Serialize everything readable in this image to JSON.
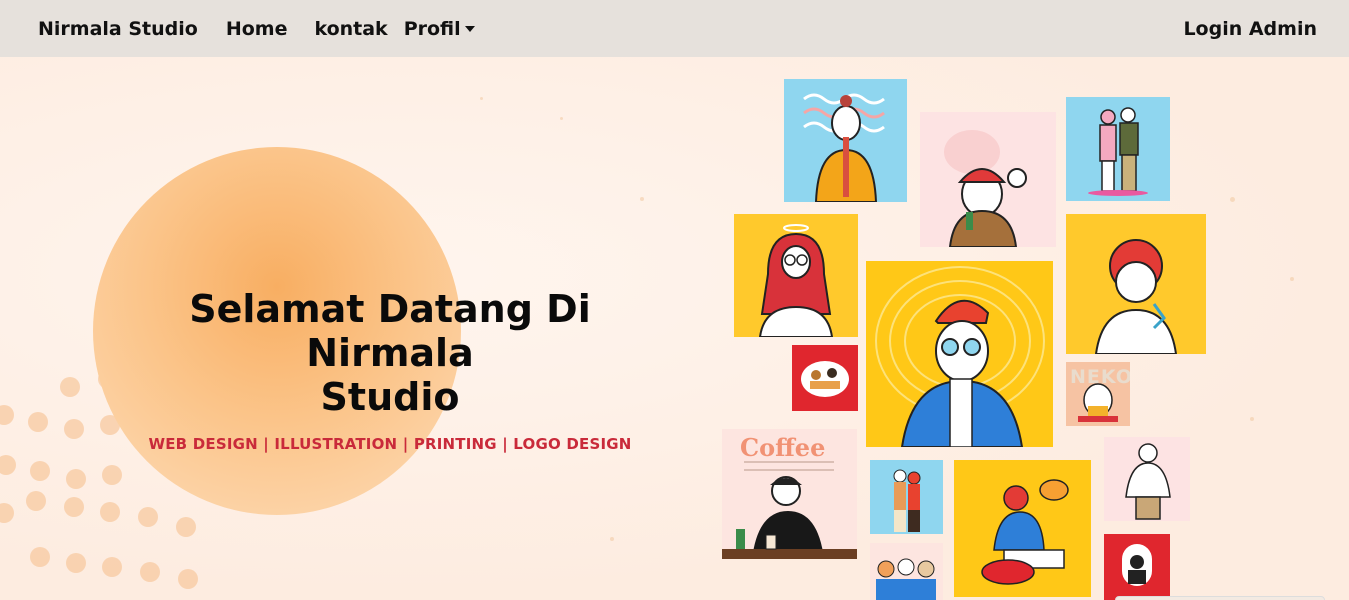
{
  "navbar": {
    "brand_icon": "camera-icon",
    "brand_glyph": "",
    "brand": "Nirmala Studio",
    "links": [
      {
        "label": "Home"
      },
      {
        "label": "kontak"
      },
      {
        "label": "Profil"
      }
    ],
    "login": "Login Admin"
  },
  "hero": {
    "title_line1": "Selamat Datang Di Nirmala",
    "title_line2": "Studio",
    "subtitle": "WEB DESIGN | ILLUSTRATION | PRINTING | LOGO DESIGN"
  },
  "collage": {
    "coffee_title": "Coffee",
    "neko_text": "NEKO"
  },
  "colors": {
    "accent_red": "#c92a3a",
    "nav_bg": "#e6e1dc",
    "hero_bg": "#fdf0e6",
    "circle": "#f8ae62"
  }
}
